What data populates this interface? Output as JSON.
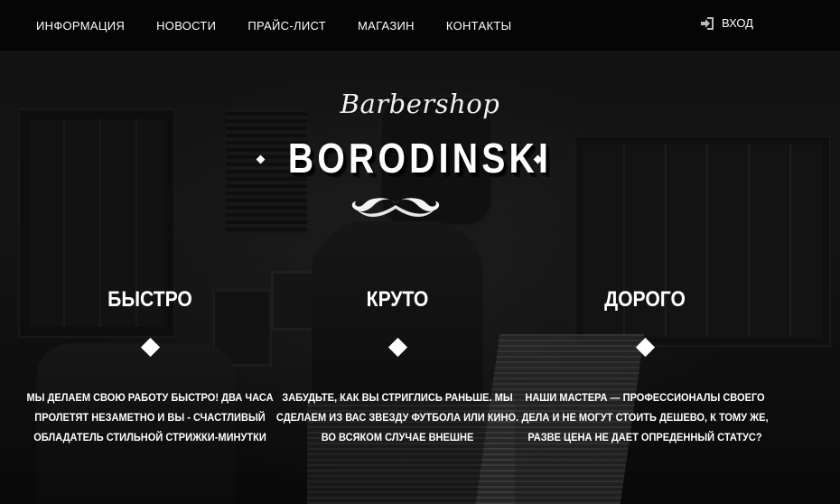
{
  "nav": {
    "items": [
      {
        "label": "ИНФОРМАЦИЯ"
      },
      {
        "label": "НОВОСТИ"
      },
      {
        "label": "ПРАЙС-ЛИСТ"
      },
      {
        "label": "МАГАЗИН"
      },
      {
        "label": "КОНТАКТЫ"
      }
    ],
    "login_label": "ВХОД"
  },
  "logo": {
    "script": "Barbershop",
    "name": "BORODINSKI"
  },
  "features": [
    {
      "title": "БЫСТРО",
      "text": "МЫ ДЕЛАЕМ СВОЮ РАБОТУ БЫСТРО! ДВА ЧАСА ПРОЛЕТЯТ НЕЗАМЕТНО И ВЫ - СЧАСТЛИВЫЙ ОБЛАДАТЕЛЬ СТИЛЬНОЙ СТРИЖКИ-МИНУТКИ"
    },
    {
      "title": "КРУТО",
      "text": "ЗАБУДЬТЕ, КАК ВЫ СТРИГЛИСЬ РАНЬШЕ. МЫ СДЕЛАЕМ ИЗ ВАС ЗВЕЗДУ ФУТБОЛА ИЛИ КИНО. ВО ВСЯКОМ СЛУЧАЕ ВНЕШНЕ"
    },
    {
      "title": "ДОРОГО",
      "text": "НАШИ МАСТЕРА — ПРОФЕССИОНАЛЫ СВОЕГО ДЕЛА И НЕ МОГУТ СТОИТЬ ДЕШЕВО, К ТОМУ ЖЕ, РАЗВЕ ЦЕНА НЕ ДАЕТ ОПРЕДЕННЫЙ СТАТУС?"
    }
  ],
  "icons": {
    "login": "login-icon",
    "logo_ornament": "mustache-icon",
    "feature_marker": "diamond-icon"
  },
  "colors": {
    "nav_background": "#050505",
    "text": "#ffffff"
  }
}
